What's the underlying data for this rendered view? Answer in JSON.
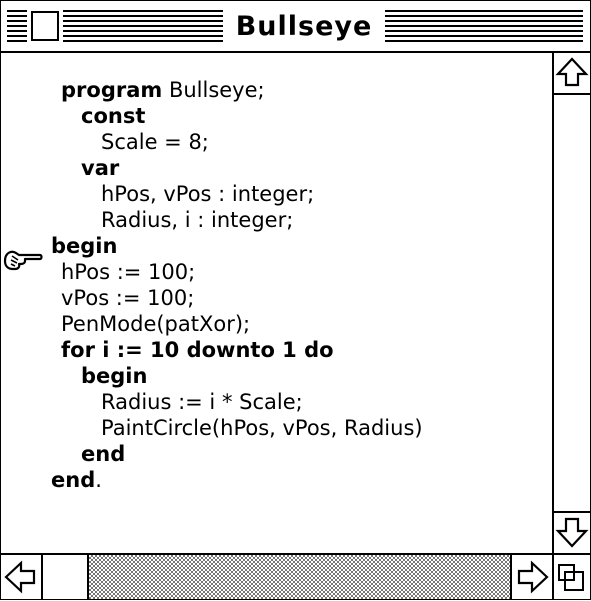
{
  "window": {
    "title": "Bullseye"
  },
  "code_lines": [
    [
      {
        "t": "program",
        "b": true
      },
      {
        "t": " Bullseye;",
        "b": false
      }
    ],
    [
      {
        "t": "const",
        "b": true
      }
    ],
    [
      {
        "t": "Scale = 8;",
        "b": false
      }
    ],
    [
      {
        "t": "var",
        "b": true
      }
    ],
    [
      {
        "t": "hPos, vPos : integer;",
        "b": false
      }
    ],
    [
      {
        "t": "Radius, i : integer;",
        "b": false
      }
    ],
    [
      {
        "t": "begin",
        "b": true
      }
    ],
    [
      {
        "t": "hPos := 100;",
        "b": false
      }
    ],
    [
      {
        "t": "vPos := 100;",
        "b": false
      }
    ],
    [
      {
        "t": "PenMode(patXor);",
        "b": false
      }
    ],
    [
      {
        "t": "for i := 10 ",
        "b": true
      },
      {
        "t": "downto",
        "b": true
      },
      {
        "t": " 1 do",
        "b": true
      }
    ],
    [
      {
        "t": "begin",
        "b": true
      }
    ],
    [
      {
        "t": "Radius := i * Scale;",
        "b": false
      }
    ],
    [
      {
        "t": "PaintCircle(hPos, vPos, Radius)",
        "b": false
      }
    ],
    [
      {
        "t": "end",
        "b": true
      }
    ],
    [
      {
        "t": "end",
        "b": true
      },
      {
        "t": ".",
        "b": false
      }
    ]
  ],
  "icons": {
    "close_box": "close-box-icon",
    "pointer": "hand-pointer-icon",
    "scroll_up": "arrow-up-icon",
    "scroll_down": "arrow-down-icon",
    "scroll_left": "arrow-left-icon",
    "scroll_right": "arrow-right-icon",
    "grow_box": "grow-box-icon"
  }
}
